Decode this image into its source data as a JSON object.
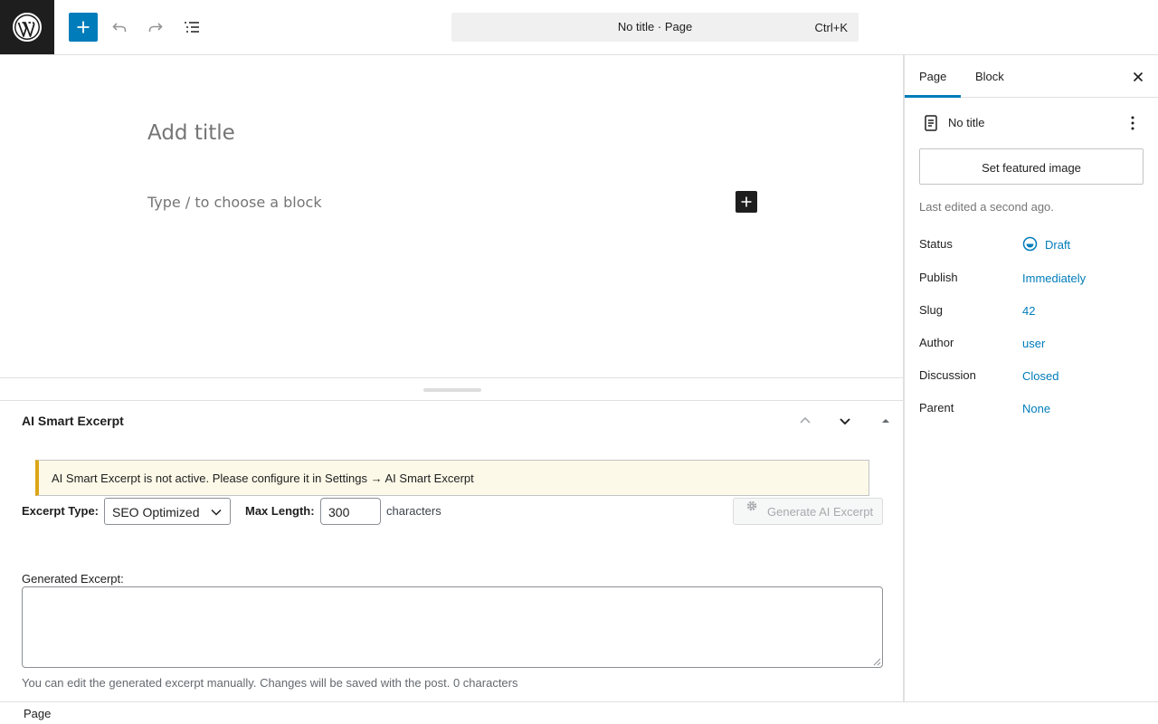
{
  "topbar": {
    "command_title": "No title · Page",
    "command_shortcut": "Ctrl+K"
  },
  "canvas": {
    "title_placeholder": "Add title",
    "block_placeholder": "Type / to choose a block"
  },
  "metabox": {
    "title": "AI Smart Excerpt",
    "notice": "AI Smart Excerpt is not active. Please configure it in Settings → AI Smart Excerpt",
    "excerpt_type_label": "Excerpt Type:",
    "excerpt_type_value": "SEO Optimized",
    "max_length_label": "Max Length:",
    "max_length_value": "300",
    "characters_label": "characters",
    "generate_button": "Generate AI Excerpt",
    "generated_label": "Generated Excerpt:",
    "generated_value": "",
    "help_text": "You can edit the generated excerpt manually. Changes will be saved with the post. 0 characters"
  },
  "footer": {
    "breadcrumb": "Page"
  },
  "sidebar": {
    "tabs": [
      "Page",
      "Block"
    ],
    "active_tab": "Page",
    "doc_title": "No title",
    "featured_image_button": "Set featured image",
    "last_edited": "Last edited a second ago.",
    "rows": [
      {
        "label": "Status",
        "value": "Draft"
      },
      {
        "label": "Publish",
        "value": "Immediately"
      },
      {
        "label": "Slug",
        "value": "42"
      },
      {
        "label": "Author",
        "value": "user"
      },
      {
        "label": "Discussion",
        "value": "Closed"
      },
      {
        "label": "Parent",
        "value": "None"
      }
    ]
  },
  "colors": {
    "accent": "#007cba",
    "dark": "#1e1e1e",
    "notice_border": "#dba617",
    "notice_bg": "#fcf9e8"
  },
  "icons": [
    "wordpress-logo-icon",
    "plus-icon",
    "undo-icon",
    "redo-icon",
    "list-view-icon",
    "close-icon",
    "page-document-icon",
    "more-vertical-icon",
    "chevron-up-icon",
    "chevron-down-icon",
    "arrow-up-icon",
    "gear-icon",
    "draft-status-icon"
  ]
}
